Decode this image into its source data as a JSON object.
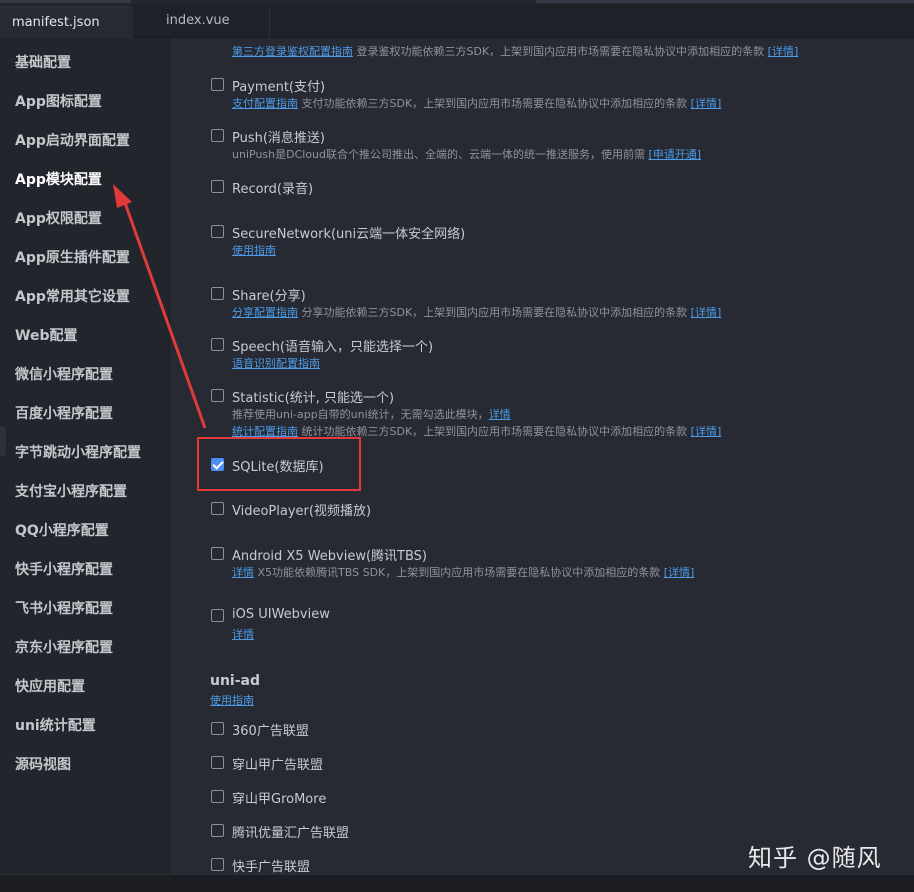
{
  "tabs": [
    {
      "label": "manifest.json",
      "active": true
    },
    {
      "label": "index.vue",
      "active": false
    }
  ],
  "sidebar": {
    "items": [
      {
        "label": "基础配置"
      },
      {
        "label": "App图标配置"
      },
      {
        "label": "App启动界面配置"
      },
      {
        "label": "App模块配置",
        "active": true
      },
      {
        "label": "App权限配置"
      },
      {
        "label": "App原生插件配置"
      },
      {
        "label": "App常用其它设置"
      },
      {
        "label": "Web配置"
      },
      {
        "label": "微信小程序配置"
      },
      {
        "label": "百度小程序配置"
      },
      {
        "label": "字节跳动小程序配置"
      },
      {
        "label": "支付宝小程序配置"
      },
      {
        "label": "QQ小程序配置"
      },
      {
        "label": "快手小程序配置"
      },
      {
        "label": "飞书小程序配置"
      },
      {
        "label": "京东小程序配置"
      },
      {
        "label": "快应用配置"
      },
      {
        "label": "uni统计配置"
      },
      {
        "label": "源码视图"
      }
    ]
  },
  "modules": {
    "oauth_desc": {
      "link": "第三方登录鉴权配置指南",
      "text": " 登录鉴权功能依赖三方SDK，上架到国内应用市场需要在隐私协议中添加相应的条款 ",
      "detail": "[详情]"
    },
    "payment": {
      "label": "Payment(支付)",
      "checked": false,
      "link": "支付配置指南",
      "text": " 支付功能依赖三方SDK，上架到国内应用市场需要在隐私协议中添加相应的条款 ",
      "detail": "[详情]"
    },
    "push": {
      "label": "Push(消息推送)",
      "checked": false,
      "text": "uniPush是DCloud联合个推公司推出、全端的、云端一体的统一推送服务，使用前需 ",
      "detail": "[申请开通]"
    },
    "record": {
      "label": "Record(录音)",
      "checked": false
    },
    "securenetwork": {
      "label": "SecureNetwork(uni云端一体安全网络)",
      "checked": false,
      "link": "使用指南"
    },
    "share": {
      "label": "Share(分享)",
      "checked": false,
      "link": "分享配置指南",
      "text": " 分享功能依赖三方SDK，上架到国内应用市场需要在隐私协议中添加相应的条款 ",
      "detail": "[详情]"
    },
    "speech": {
      "label": "Speech(语音输入，只能选择一个)",
      "checked": false,
      "link": "语音识别配置指南"
    },
    "statistic": {
      "label": "Statistic(统计, 只能选一个)",
      "checked": false,
      "text1": "推荐使用uni-app自带的uni统计，无需勾选此模块，",
      "detail1": "详情",
      "link": "统计配置指南",
      "text2": " 统计功能依赖三方SDK，上架到国内应用市场需要在隐私协议中添加相应的条款 ",
      "detail2": "[详情]"
    },
    "sqlite": {
      "label": "SQLite(数据库)",
      "checked": true
    },
    "videoplayer": {
      "label": "VideoPlayer(视频播放)",
      "checked": false
    },
    "x5": {
      "label": "Android X5 Webview(腾讯TBS)",
      "checked": false,
      "link": "详情",
      "text": " X5功能依赖腾讯TBS SDK，上架到国内应用市场需要在隐私协议中添加相应的条款 ",
      "detail": "[详情]"
    },
    "uiwebview": {
      "label": "iOS UIWebview",
      "checked": false,
      "link": "详情"
    }
  },
  "uniad": {
    "title": "uni-ad",
    "guide": "使用指南",
    "items": [
      {
        "label": "360广告联盟",
        "checked": false
      },
      {
        "label": "穿山甲广告联盟",
        "checked": false
      },
      {
        "label": "穿山甲GroMore",
        "checked": false
      },
      {
        "label": "腾讯优量汇广告联盟",
        "checked": false
      },
      {
        "label": "快手广告联盟",
        "checked": false
      }
    ]
  },
  "annotation": {
    "color": "#e03a3a"
  },
  "watermark": "知乎 @随风"
}
